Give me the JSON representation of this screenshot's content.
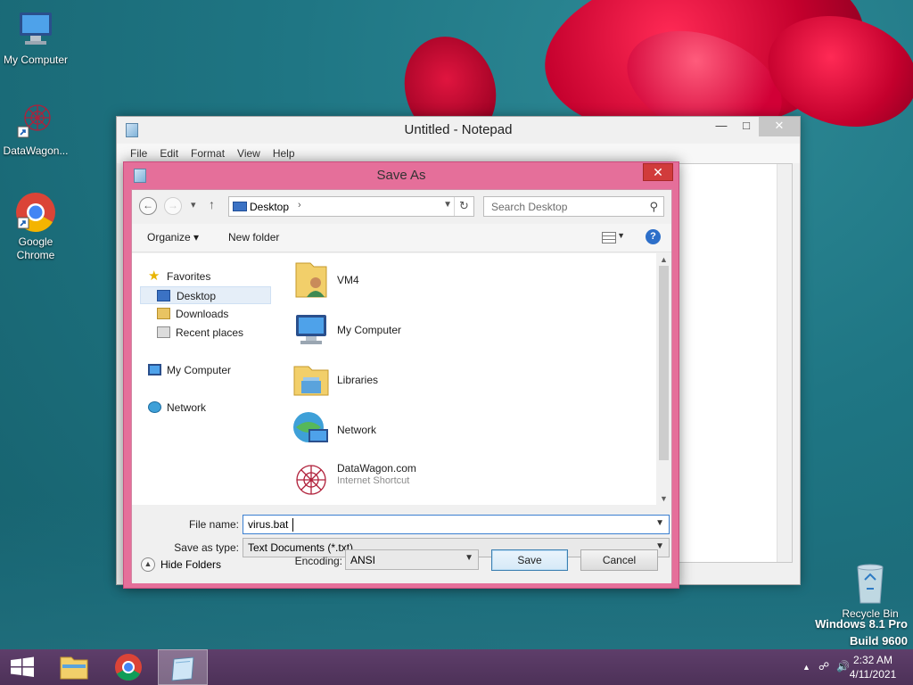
{
  "desktop": {
    "icons": [
      {
        "label": "My Computer"
      },
      {
        "label": "DataWagon..."
      },
      {
        "label": "Google Chrome"
      }
    ],
    "recycle_bin": "Recycle Bin",
    "watermark": [
      "Windows 8.1 Pro",
      "Build 9600"
    ]
  },
  "notepad": {
    "title": "Untitled - Notepad",
    "menu": [
      "File",
      "Edit",
      "Format",
      "View",
      "Help"
    ],
    "controls": {
      "minimize": "—",
      "maximize": "□",
      "close": "✕"
    }
  },
  "save_dialog": {
    "title": "Save As",
    "close": "✕",
    "address": {
      "location": "Desktop",
      "separator": "›"
    },
    "search": {
      "placeholder": "Search Desktop"
    },
    "toolbar": {
      "organize": "Organize ▾",
      "new_folder": "New folder",
      "help": "?"
    },
    "nav": {
      "favorites": "Favorites",
      "items": [
        "Desktop",
        "Downloads",
        "Recent places"
      ],
      "computer": "My Computer",
      "network": "Network"
    },
    "files": [
      {
        "name": "VM4",
        "sub": ""
      },
      {
        "name": "My Computer",
        "sub": ""
      },
      {
        "name": "Libraries",
        "sub": ""
      },
      {
        "name": "Network",
        "sub": ""
      },
      {
        "name": "DataWagon.com",
        "sub": "Internet Shortcut"
      }
    ],
    "form": {
      "file_name_label": "File name:",
      "file_name_value": "virus.bat",
      "save_type_label": "Save as type:",
      "save_type_value": "Text Documents (*.txt)",
      "encoding_label": "Encoding:",
      "encoding_value": "ANSI",
      "hide_folders": "Hide Folders",
      "save": "Save",
      "cancel": "Cancel"
    }
  },
  "taskbar": {
    "time": "2:32 AM",
    "date": "4/11/2021"
  },
  "colors": {
    "dialog_frame": "#e56f9a",
    "taskbar": "#5e3e6a",
    "accent_blue": "#3a7fd0"
  }
}
